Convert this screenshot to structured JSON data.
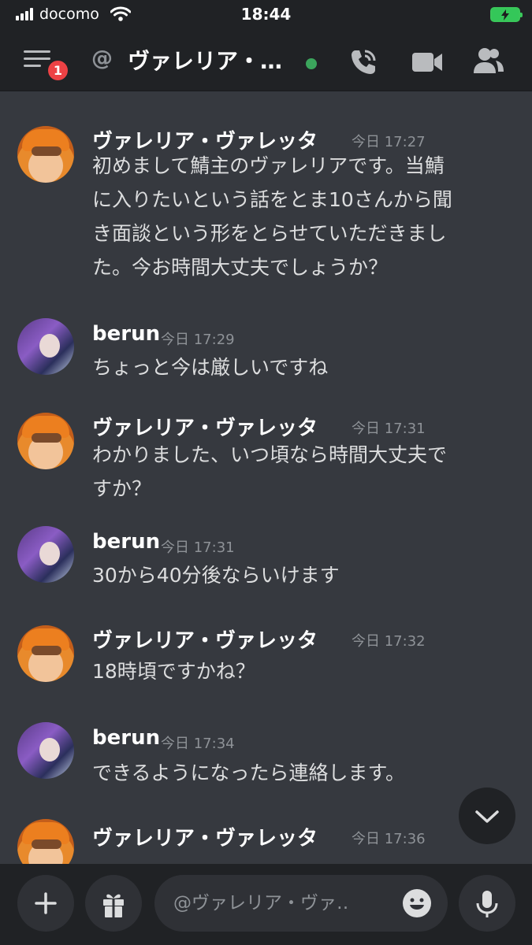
{
  "status_bar": {
    "carrier": "docomo",
    "time": "18:44"
  },
  "header": {
    "unread_badge": "1",
    "at_symbol": "@",
    "channel_name": "ヴァレリア・…"
  },
  "messages": [
    {
      "author": "ヴァレリア・ヴァレッタ",
      "timestamp": "今日 17:27",
      "lines": [
        "初めまして鯖主のヴァレリアです。当鯖",
        "に入りたいという話をとま10さんから聞",
        "き面談という形をとらせていただきまし",
        "た。今お時間大丈夫でしょうか？"
      ]
    },
    {
      "author": "berun",
      "timestamp": "今日 17:29",
      "lines": [
        "ちょっと今は厳しいですね"
      ]
    },
    {
      "author": "ヴァレリア・ヴァレッタ",
      "timestamp": "今日 17:31",
      "lines": [
        "わかりました、いつ頃なら時間大丈夫で",
        "すか？"
      ]
    },
    {
      "author": "berun",
      "timestamp": "今日 17:31",
      "lines": [
        "30から40分後ならいけます"
      ]
    },
    {
      "author": "ヴァレリア・ヴァレッタ",
      "timestamp": "今日 17:32",
      "lines": [
        "18時頃ですかね？"
      ]
    },
    {
      "author": "berun",
      "timestamp": "今日 17:34",
      "lines": [
        "できるようになったら連絡します。"
      ]
    },
    {
      "author": "ヴァレリア・ヴァレッタ",
      "timestamp": "今日 17:36",
      "lines": []
    }
  ],
  "input": {
    "placeholder": "@ヴァレリア・ヴァ‥"
  },
  "colors": {
    "background": "#36393f",
    "header": "#202225",
    "online": "#3ba55c",
    "badge": "#ed4245",
    "battery": "#34c759"
  },
  "icons": [
    "signal-icon",
    "wifi-icon",
    "battery-charging-icon",
    "hamburger-menu-icon",
    "phone-call-icon",
    "video-camera-icon",
    "members-icon",
    "chevron-down-icon",
    "plus-icon",
    "gift-icon",
    "emoji-icon",
    "microphone-icon"
  ]
}
